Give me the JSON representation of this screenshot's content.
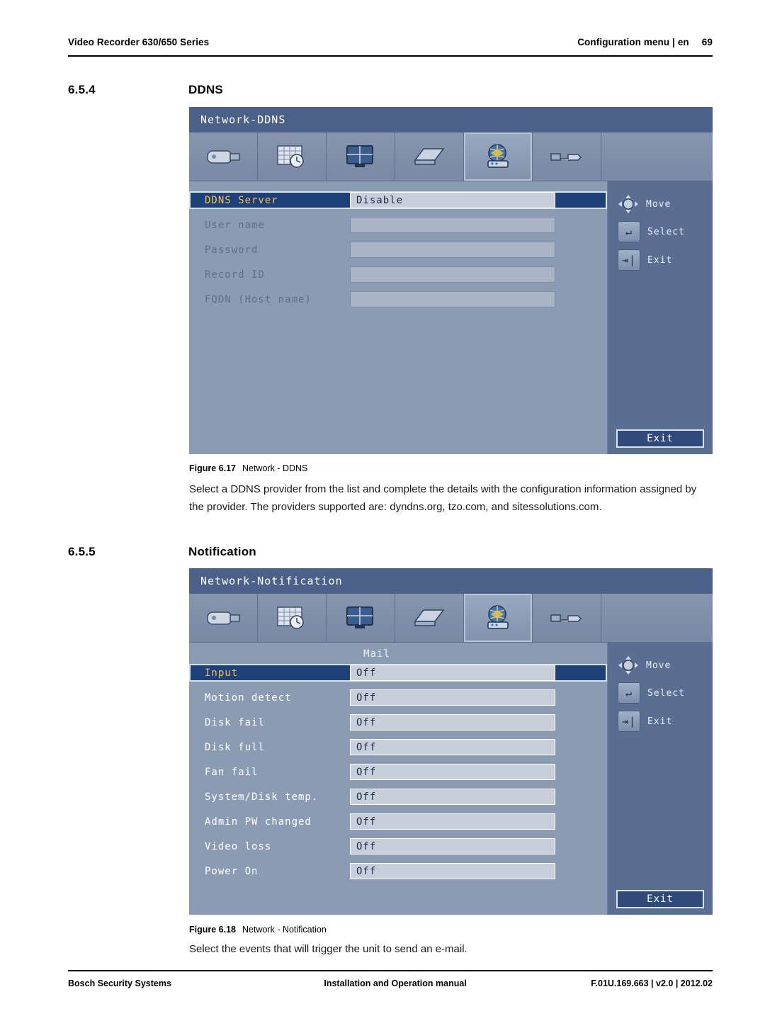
{
  "header": {
    "left": "Video Recorder 630/650 Series",
    "right_label": "Configuration menu | en",
    "page_number": "69"
  },
  "footer": {
    "left": "Bosch Security Systems",
    "center": "Installation and Operation manual",
    "right": "F.01U.169.663 | v2.0 | 2012.02"
  },
  "sections": [
    {
      "number": "6.5.4",
      "title": "DDNS",
      "figure": {
        "number": "Figure 6.17",
        "caption": "Network - DDNS"
      },
      "body": "Select a DDNS provider from the list and complete the details with the configuration information assigned by the provider. The providers supported are: dyndns.org, tzo.com, and sitessolutions.com.",
      "osd": {
        "title": "Network-DDNS",
        "icons": [
          "camera-icon",
          "schedule-icon",
          "display-icon",
          "storage-icon",
          "network-icon",
          "system-icon"
        ],
        "selected_icon_index": 4,
        "fields": [
          {
            "label": "DDNS Server",
            "value": "Disable",
            "state": "highlight"
          },
          {
            "label": "User name",
            "value": "",
            "state": "disabled"
          },
          {
            "label": "Password",
            "value": "",
            "state": "disabled"
          },
          {
            "label": "Record ID",
            "value": "",
            "state": "disabled"
          },
          {
            "label": "FQDN (Host name)",
            "value": "",
            "state": "disabled"
          }
        ],
        "hints": [
          {
            "icon": "dpad-icon",
            "label": "Move"
          },
          {
            "icon": "enter-icon",
            "label": "Select"
          },
          {
            "icon": "exit-arrow-icon",
            "label": "Exit"
          }
        ],
        "exit_button": "Exit"
      }
    },
    {
      "number": "6.5.5",
      "title": "Notification",
      "figure": {
        "number": "Figure 6.18",
        "caption": "Network - Notification"
      },
      "body": "Select the events that will trigger the unit to send an e-mail.",
      "osd": {
        "title": "Network-Notification",
        "icons": [
          "camera-icon",
          "schedule-icon",
          "display-icon",
          "storage-icon",
          "network-icon",
          "system-icon"
        ],
        "selected_icon_index": 4,
        "group_heading": "Mail",
        "fields": [
          {
            "label": "Input",
            "value": "Off",
            "state": "highlight"
          },
          {
            "label": "Motion detect",
            "value": "Off",
            "state": "enabled"
          },
          {
            "label": "Disk fail",
            "value": "Off",
            "state": "enabled"
          },
          {
            "label": "Disk full",
            "value": "Off",
            "state": "enabled"
          },
          {
            "label": "Fan fail",
            "value": "Off",
            "state": "enabled"
          },
          {
            "label": "System/Disk temp.",
            "value": "Off",
            "state": "enabled"
          },
          {
            "label": "Admin PW changed",
            "value": "Off",
            "state": "enabled"
          },
          {
            "label": "Video loss",
            "value": "Off",
            "state": "enabled"
          },
          {
            "label": "Power On",
            "value": "Off",
            "state": "enabled"
          }
        ],
        "hints": [
          {
            "icon": "dpad-icon",
            "label": "Move"
          },
          {
            "icon": "enter-icon",
            "label": "Select"
          },
          {
            "icon": "exit-arrow-icon",
            "label": "Exit"
          }
        ],
        "exit_button": "Exit"
      }
    }
  ],
  "colors": {
    "osd_title_bar": "#4b618a",
    "osd_background": "#8b9bb4",
    "osd_sidebar": "#5a6e92",
    "highlight_row": "#1d3f7a",
    "highlight_label": "#f2c14b"
  }
}
